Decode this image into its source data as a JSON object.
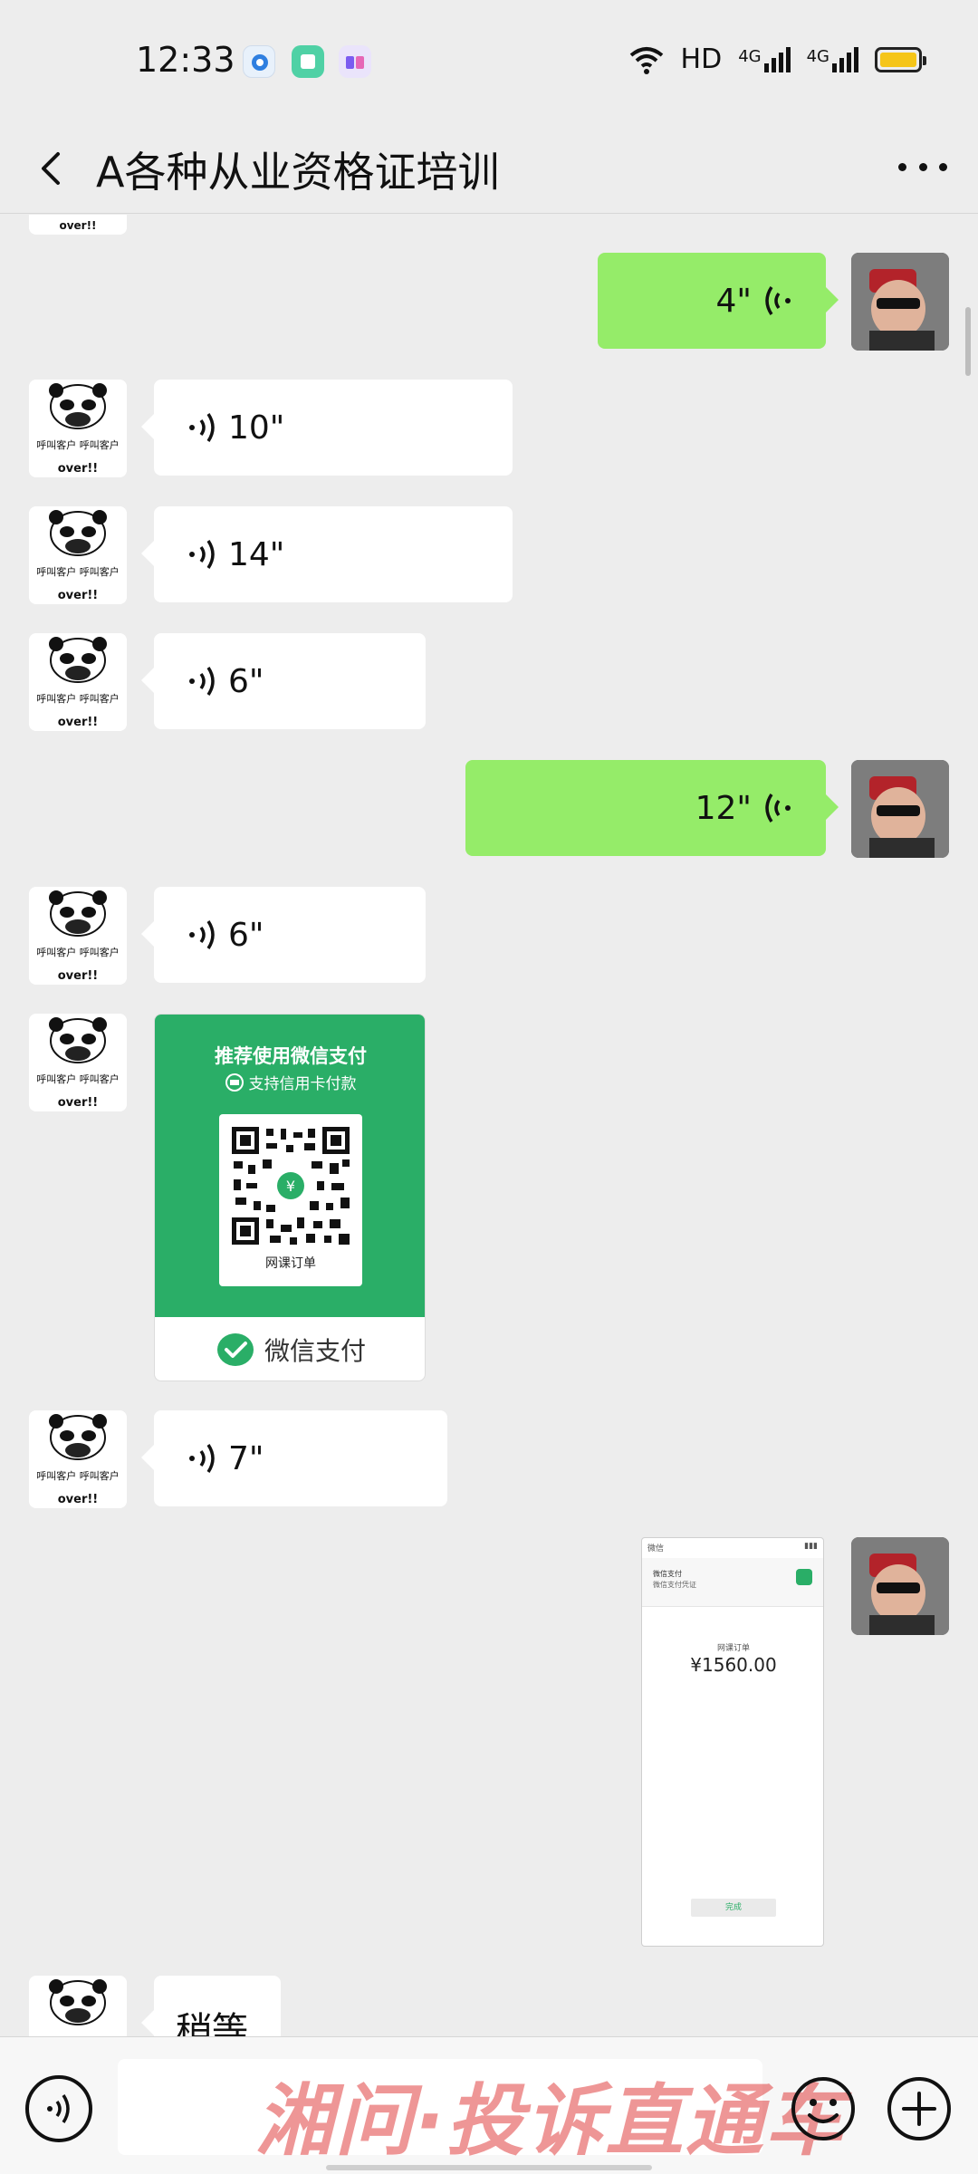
{
  "status_bar": {
    "time": "12:33",
    "network": "HD",
    "signal_1": "4G",
    "signal_2": "4G",
    "battery_color": "#f5c518"
  },
  "header": {
    "title": "A各种从业资格证培训"
  },
  "messages": [
    {
      "side": "right",
      "type": "voice",
      "duration": "4\""
    },
    {
      "side": "left",
      "type": "voice",
      "duration": "10\""
    },
    {
      "side": "left",
      "type": "voice",
      "duration": "14\""
    },
    {
      "side": "left",
      "type": "voice",
      "duration": "6\""
    },
    {
      "side": "right",
      "type": "voice",
      "duration": "12\""
    },
    {
      "side": "left",
      "type": "voice",
      "duration": "6\""
    },
    {
      "side": "left",
      "type": "payment_card",
      "headline": "推荐使用微信支付",
      "subline": "支持信用卡付款",
      "qr_label": "网课订单",
      "footer": "微信支付"
    },
    {
      "side": "left",
      "type": "voice",
      "duration": "7\""
    },
    {
      "side": "right",
      "type": "image",
      "screenshot_status": "微信",
      "screenshot_line1": "微信支付",
      "screenshot_line2": "微信支付凭证",
      "screenshot_order": "网课订单",
      "screenshot_amount": "¥1560.00",
      "screenshot_done": "完成"
    },
    {
      "side": "left",
      "type": "text",
      "text": "稍等"
    }
  ],
  "avatar_panda": {
    "caption_1": "呼叫客户 呼叫客户",
    "caption_2": "over!!"
  },
  "bottom_bar": {
    "watermark": "湘问·投诉直通车"
  },
  "colors": {
    "background": "#ededed",
    "sent_bubble": "#95ec69",
    "received_bubble": "#ffffff",
    "wechat_pay_green": "#2aae67"
  },
  "icons": {
    "back": "chevron-left-icon",
    "more": "more-dots-icon",
    "voice_input": "voice-icon",
    "emoji": "emoji-icon",
    "plus": "plus-icon"
  }
}
